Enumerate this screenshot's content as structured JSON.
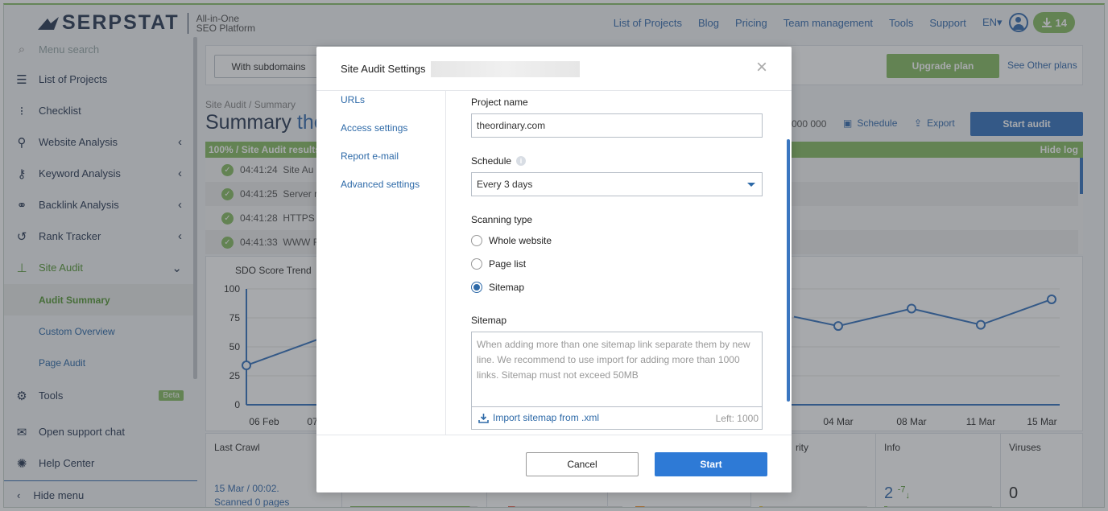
{
  "header": {
    "logo_text": "SERPSTAT",
    "logo_tag_line1": "All-in-One",
    "logo_tag_line2": "SEO Platform",
    "nav": [
      "List of Projects",
      "Blog",
      "Pricing",
      "Team management",
      "Tools",
      "Support"
    ],
    "lang": "EN",
    "downloads_count": "14"
  },
  "sidebar": {
    "search_placeholder": "Menu search",
    "items": [
      {
        "label": "List of Projects",
        "icon": "list-icon"
      },
      {
        "label": "Checklist",
        "icon": "checklist-icon"
      },
      {
        "label": "Website Analysis",
        "icon": "analysis-icon"
      },
      {
        "label": "Keyword Analysis",
        "icon": "key-icon"
      },
      {
        "label": "Backlink Analysis",
        "icon": "link-icon"
      },
      {
        "label": "Rank Tracker",
        "icon": "history-icon"
      },
      {
        "label": "Site Audit",
        "icon": "sitemap-icon"
      }
    ],
    "sub_items": [
      "Audit Summary",
      "Custom Overview",
      "Page Audit"
    ],
    "tools_label": "Tools",
    "beta_label": "Beta",
    "support_chat": "Open support chat",
    "help_center": "Help Center",
    "hide_menu": "Hide menu"
  },
  "main": {
    "with_subdomains": "With subdomains",
    "upgrade_plan": "Upgrade plan",
    "see_other_plans": "See Other plans",
    "breadcrumb": "Site Audit / Summary",
    "title_prefix": "Summary",
    "title_highlight": "the",
    "limit_text": "000 000",
    "schedule_label": "Schedule",
    "export_label": "Export",
    "start_audit": "Start audit",
    "progress_text": "100% / Site Audit results",
    "hide_log": "Hide log",
    "log_rows": [
      {
        "time": "04:41:24",
        "text": "Site Au"
      },
      {
        "time": "04:41:25",
        "text": "Server r"
      },
      {
        "time": "04:41:28",
        "text": "HTTPS"
      },
      {
        "time": "04:41:33",
        "text": "WWW F"
      }
    ],
    "chart_title": "SDO Score Trend",
    "stats": {
      "last_crawl_label": "Last Crawl",
      "last_crawl_date": "15 Mar / 00:02.",
      "scanned_pages": "Scanned 0 pages",
      "priority_label": "rity",
      "info_label": "Info",
      "info_value": "2",
      "info_delta": "-7",
      "viruses_label": "Viruses",
      "viruses_value": "0"
    }
  },
  "chart_data": {
    "type": "line",
    "title": "SDO Score Trend",
    "x_ticks_visible": [
      "06 Feb",
      "07",
      "04 Mar",
      "08 Mar",
      "11 Mar",
      "15 Mar"
    ],
    "y_ticks": [
      100,
      75,
      50,
      25,
      0
    ],
    "ylim": [
      0,
      100
    ],
    "visible_points_left": [
      {
        "x": "06 Feb",
        "y": 34
      },
      {
        "x": "07",
        "y": 58
      }
    ],
    "visible_points_right": [
      {
        "x": "",
        "y": 76
      },
      {
        "x": "04 Mar",
        "y": 68
      },
      {
        "x": "08 Mar",
        "y": 83
      },
      {
        "x": "11 Mar",
        "y": 69
      },
      {
        "x": "15 Mar",
        "y": 91
      }
    ],
    "line_color": "#3a76c0"
  },
  "modal": {
    "title": "Site Audit Settings",
    "nav": [
      "URLs",
      "Access settings",
      "Report e-mail",
      "Advanced settings"
    ],
    "project_name_label": "Project name",
    "project_name_value": "theordinary.com",
    "schedule_label": "Schedule",
    "schedule_value": "Every 3 days",
    "scanning_type_label": "Scanning type",
    "scanning_options": [
      "Whole website",
      "Page list",
      "Sitemap"
    ],
    "scanning_selected": "Sitemap",
    "sitemap_label": "Sitemap",
    "sitemap_placeholder": "When adding more than one sitemap link separate them by new line. We recommend to use import for adding more than 1000 links. Sitemap must not exceed 50MB",
    "import_link": "Import sitemap from .xml",
    "left_count": "Left: 1000",
    "cancel_label": "Cancel",
    "start_label": "Start"
  }
}
